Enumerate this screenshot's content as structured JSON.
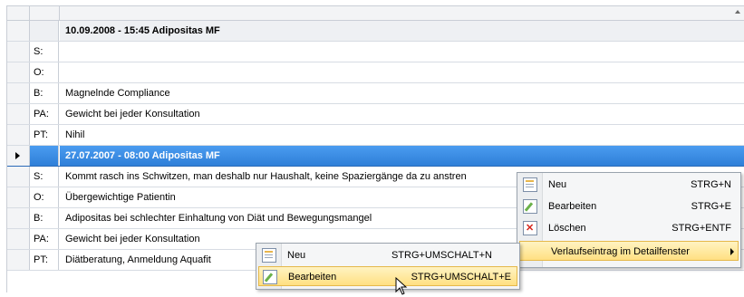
{
  "grid": {
    "rows": [
      {
        "kind": "header",
        "label": "",
        "value": "10.09.2008 - 15:45 Adipositas MF"
      },
      {
        "kind": "data",
        "label": "S:",
        "value": ""
      },
      {
        "kind": "data",
        "label": "O:",
        "value": ""
      },
      {
        "kind": "data",
        "label": "B:",
        "value": "Magnelnde Compliance"
      },
      {
        "kind": "data",
        "label": "PA:",
        "value": "Gewicht bei jeder Konsultation"
      },
      {
        "kind": "data",
        "label": "PT:",
        "value": "Nihil"
      },
      {
        "kind": "active",
        "label": "",
        "value": "27.07.2007 - 08:00 Adipositas MF"
      },
      {
        "kind": "data",
        "label": "S:",
        "value": "Kommt rasch ins Schwitzen, man deshalb nur Haushalt, keine Spaziergänge da zu anstren"
      },
      {
        "kind": "data",
        "label": "O:",
        "value": "Übergewichtige Patientin"
      },
      {
        "kind": "data",
        "label": "B:",
        "value": "Adipositas bei schlechter Einhaltung von Diät und Bewegungsmangel"
      },
      {
        "kind": "data",
        "label": "PA:",
        "value": "Gewicht bei jeder Konsultation"
      },
      {
        "kind": "data",
        "label": "PT:",
        "value": "Diätberatung, Anmeldung Aquafit"
      }
    ]
  },
  "context_menu": {
    "items": [
      {
        "label": "Neu",
        "shortcut": "STRG+N",
        "icon": "new-document-icon"
      },
      {
        "label": "Bearbeiten",
        "shortcut": "STRG+E",
        "icon": "edit-icon"
      },
      {
        "label": "Löschen",
        "shortcut": "STRG+ENTF",
        "icon": "delete-icon"
      },
      {
        "label": "Verlaufseintrag im Detailfenster",
        "shortcut": "",
        "icon": ""
      }
    ]
  },
  "sub_menu": {
    "items": [
      {
        "label": "Neu",
        "shortcut": "STRG+UMSCHALT+N",
        "icon": "new-document-icon"
      },
      {
        "label": "Bearbeiten",
        "shortcut": "STRG+UMSCHALT+E",
        "icon": "edit-icon"
      }
    ]
  }
}
